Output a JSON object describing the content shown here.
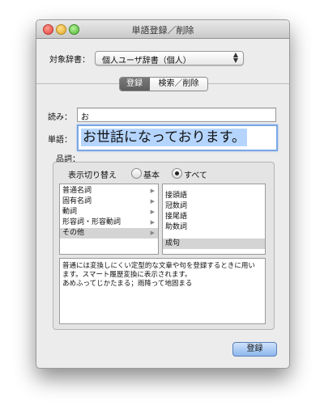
{
  "window": {
    "title": "単語登録／削除"
  },
  "dictionary": {
    "label": "対象辞書：",
    "selected": "個人ユーザ辞書（個人）"
  },
  "tabs": [
    {
      "label": "登録",
      "selected": true
    },
    {
      "label": "検索／削除",
      "selected": false
    }
  ],
  "yomi": {
    "label": "読み：",
    "value": "お"
  },
  "tango": {
    "label": "単語：",
    "value": "お世話になっております。"
  },
  "hinshi": {
    "label": "品詞：",
    "display_toggle_label": "表示切り替え",
    "options": [
      {
        "label": "基本",
        "checked": false
      },
      {
        "label": "すべて",
        "checked": true
      }
    ],
    "categories": [
      {
        "label": "普通名詞",
        "has_submenu": true,
        "selected": false
      },
      {
        "label": "固有名詞",
        "has_submenu": true,
        "selected": false
      },
      {
        "label": "動詞",
        "has_submenu": true,
        "selected": false
      },
      {
        "label": "形容詞・形容動詞",
        "has_submenu": true,
        "selected": false
      },
      {
        "label": "その他",
        "has_submenu": true,
        "selected": true
      }
    ],
    "subcategories": [
      {
        "label": "接頭語",
        "selected": false
      },
      {
        "label": "冠数詞",
        "selected": false
      },
      {
        "label": "接尾語",
        "selected": false
      },
      {
        "label": "助数詞",
        "selected": false
      },
      {
        "label": "成句",
        "selected": true
      }
    ],
    "description_lines": [
      "普通には変換しにくい定型的な文章や句を登録するときに用い",
      "ます。スマート履歴変換に表示されます。",
      "あめふってじかたまる；雨降って地固まる"
    ]
  },
  "buttons": {
    "register": "登録"
  },
  "icons": {
    "submenu": "chevron-right-icon",
    "popup": "up-down-arrows-icon"
  }
}
